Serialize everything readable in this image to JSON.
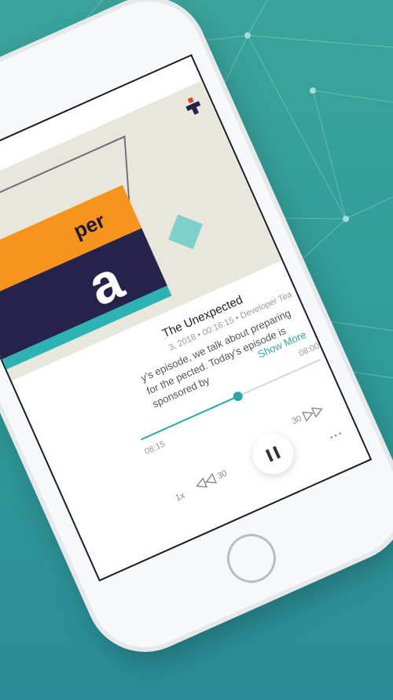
{
  "colors": {
    "background": "#3aa39b",
    "accent": "#2aa9a3",
    "artwork_orange": "#f7941d",
    "artwork_navy": "#25234a"
  },
  "episode": {
    "title": "The Unexpected",
    "meta": "3, 2018 • 00:16:15 • Developer Tea",
    "description": "y's episode, we talk about preparing for the pected. Today's episode is sponsored by",
    "show_more": "Show More"
  },
  "artwork": {
    "word_top": "per",
    "word_big": "a"
  },
  "player": {
    "progress": 0.54,
    "elapsed": "08:15",
    "total": "08:00",
    "skip_back": "30",
    "skip_forward": "30",
    "speed": "1x",
    "more_label": "...",
    "state": "playing"
  },
  "icons": {
    "pause": "pause-icon",
    "rewind": "rewind-30-icon",
    "forward": "forward-30-icon",
    "more": "more-dots-icon",
    "logo": "developer-tea-logo-icon"
  }
}
